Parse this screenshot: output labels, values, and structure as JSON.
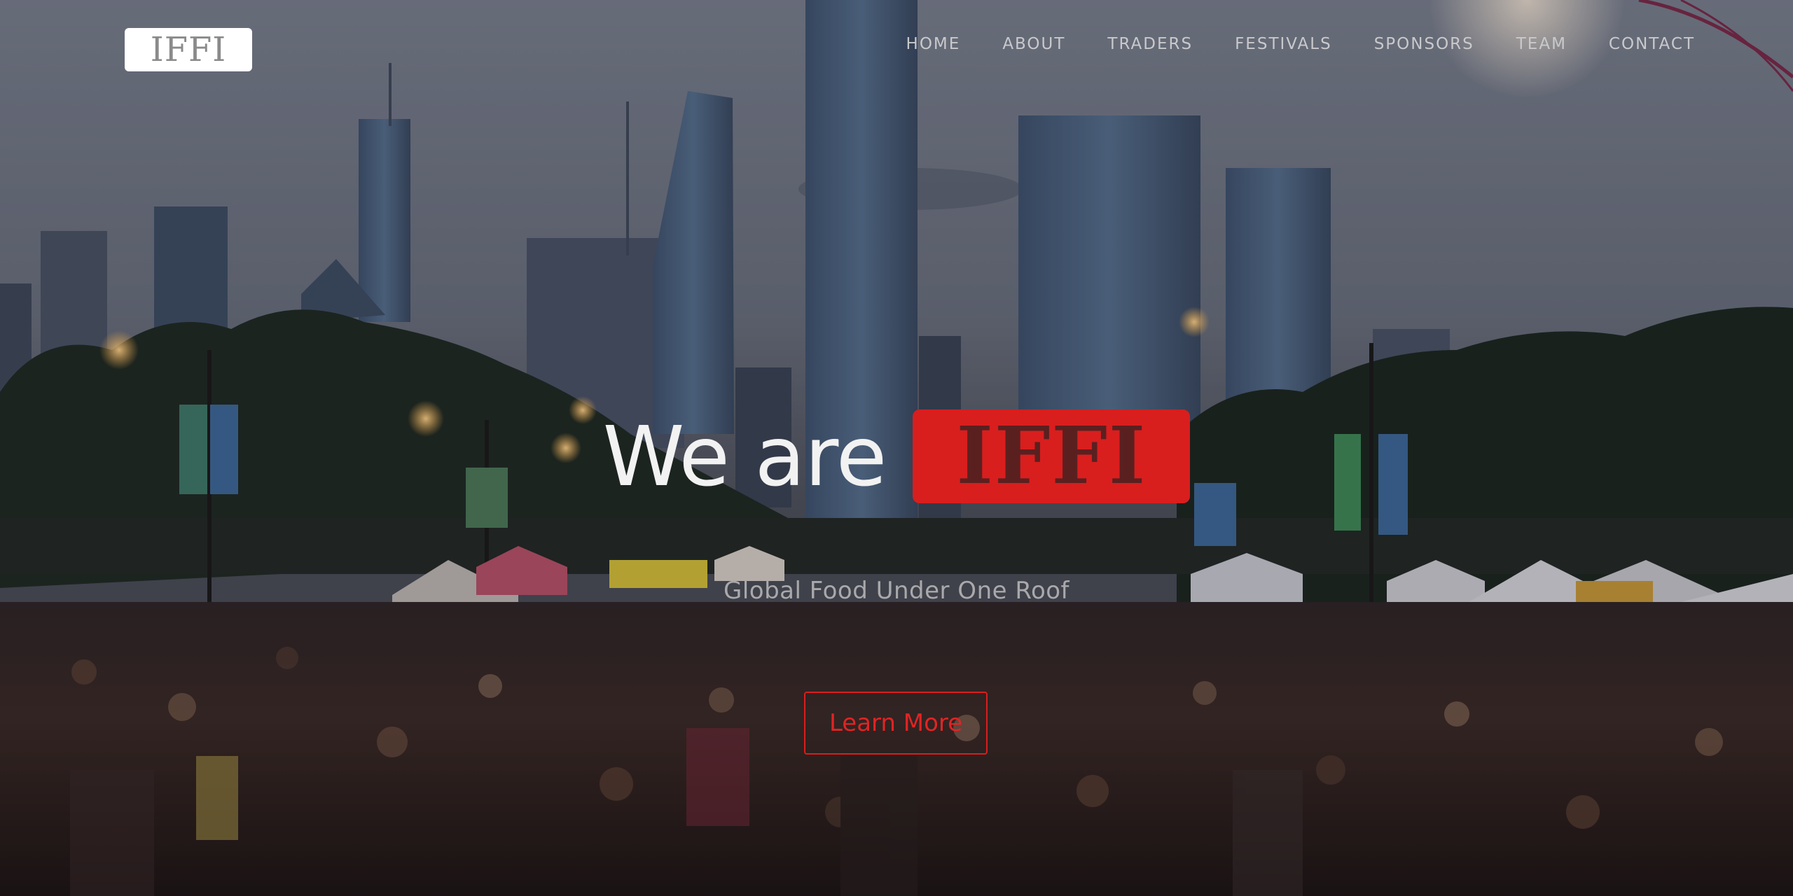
{
  "logo": {
    "text": "IFFI"
  },
  "nav": {
    "items": [
      {
        "label": "HOME"
      },
      {
        "label": "ABOUT"
      },
      {
        "label": "TRADERS"
      },
      {
        "label": "FESTIVALS"
      },
      {
        "label": "SPONSORS"
      },
      {
        "label": "TEAM"
      },
      {
        "label": "CONTACT"
      }
    ]
  },
  "hero": {
    "headline_prefix": "We are",
    "headline_badge": "IFFI",
    "tagline": "Global Food Under One Roof",
    "cta_label": "Learn More"
  },
  "colors": {
    "accent": "#d91e1e",
    "nav_text": "#c9c9cc",
    "headline_text": "#f2f2f2"
  }
}
